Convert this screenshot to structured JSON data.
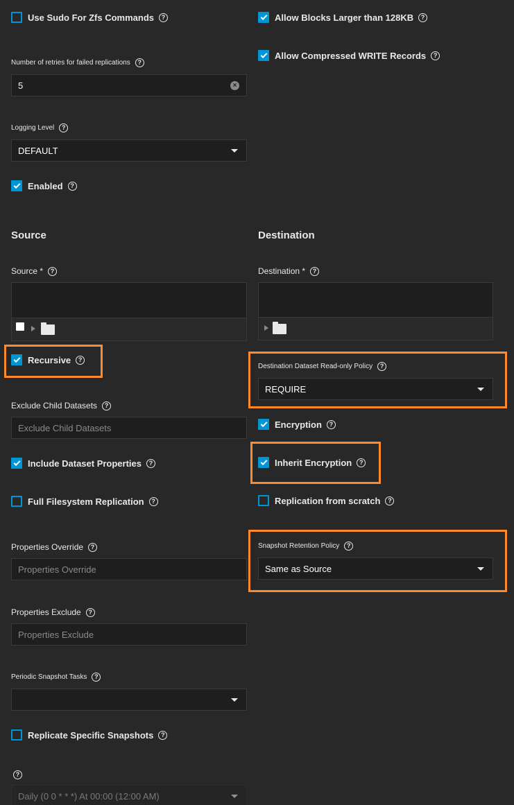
{
  "left": {
    "use_sudo": {
      "label": "Use Sudo For Zfs Commands",
      "checked": false
    },
    "retries": {
      "label": "Number of retries for failed replications",
      "value": "5"
    },
    "logging": {
      "label": "Logging Level",
      "value": "DEFAULT"
    },
    "enabled": {
      "label": "Enabled",
      "checked": true
    }
  },
  "right_top": {
    "large_blocks": {
      "label": "Allow Blocks Larger than 128KB",
      "checked": true
    },
    "compressed": {
      "label": "Allow Compressed WRITE Records",
      "checked": true
    }
  },
  "source": {
    "title": "Source",
    "field_label": "Source *",
    "recursive": {
      "label": "Recursive",
      "checked": true
    },
    "exclude_child": {
      "label": "Exclude Child Datasets",
      "placeholder": "Exclude Child Datasets"
    },
    "include_props": {
      "label": "Include Dataset Properties",
      "checked": true
    },
    "full_fs": {
      "label": "Full Filesystem Replication",
      "checked": false
    },
    "props_override": {
      "label": "Properties Override",
      "placeholder": "Properties Override"
    },
    "props_exclude": {
      "label": "Properties Exclude",
      "placeholder": "Properties Exclude"
    },
    "periodic": {
      "label": "Periodic Snapshot Tasks",
      "value": ""
    },
    "replicate_specific": {
      "label": "Replicate Specific Snapshots",
      "checked": false
    },
    "schedule": {
      "value": "Daily (0 0 * * *)  At 00:00 (12:00 AM)"
    }
  },
  "destination": {
    "title": "Destination",
    "field_label": "Destination *",
    "readonly_policy": {
      "label": "Destination Dataset Read-only Policy",
      "value": "REQUIRE"
    },
    "encryption": {
      "label": "Encryption",
      "checked": true
    },
    "inherit_encryption": {
      "label": "Inherit Encryption",
      "checked": true
    },
    "from_scratch": {
      "label": "Replication from scratch",
      "checked": false
    },
    "retention": {
      "label": "Snapshot Retention Policy",
      "value": "Same as Source"
    }
  },
  "icons": {
    "help": "?",
    "clear": "×"
  },
  "colors": {
    "accent": "#0095d5",
    "highlight": "#ff8a2b",
    "background": "#282828"
  }
}
